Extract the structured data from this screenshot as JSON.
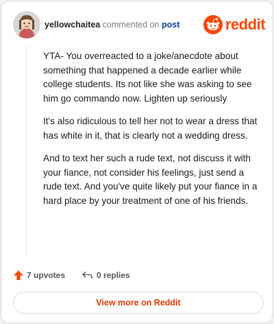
{
  "comment": {
    "username": "yellowchaitea",
    "action_text": "commented on",
    "post_link": "post",
    "paragraphs": [
      "YTA- You overreacted to a joke/anecdote about something that happened a decade earlier while college students. Its not like she was asking to see him go commando now. Lighten up seriously",
      "It's also ridiculous to tell her not to wear a dress that has white in it, that is clearly not a wedding dress.",
      "And to text her such a rude text, not discuss it with your fiance, not consider his feelings, just send a rude text. And you've quite likely put your fiance in a hard place by your treatment of one of his friends."
    ]
  },
  "brand": {
    "wordmark": "reddit",
    "color": "#ff4500"
  },
  "footer": {
    "upvotes": "7 upvotes",
    "replies": "0 replies",
    "view_more": "View more on Reddit"
  },
  "icons": {
    "upvote": "upvote-arrow-icon",
    "reply": "reply-arrow-icon",
    "logo": "reddit-snoo-icon"
  }
}
